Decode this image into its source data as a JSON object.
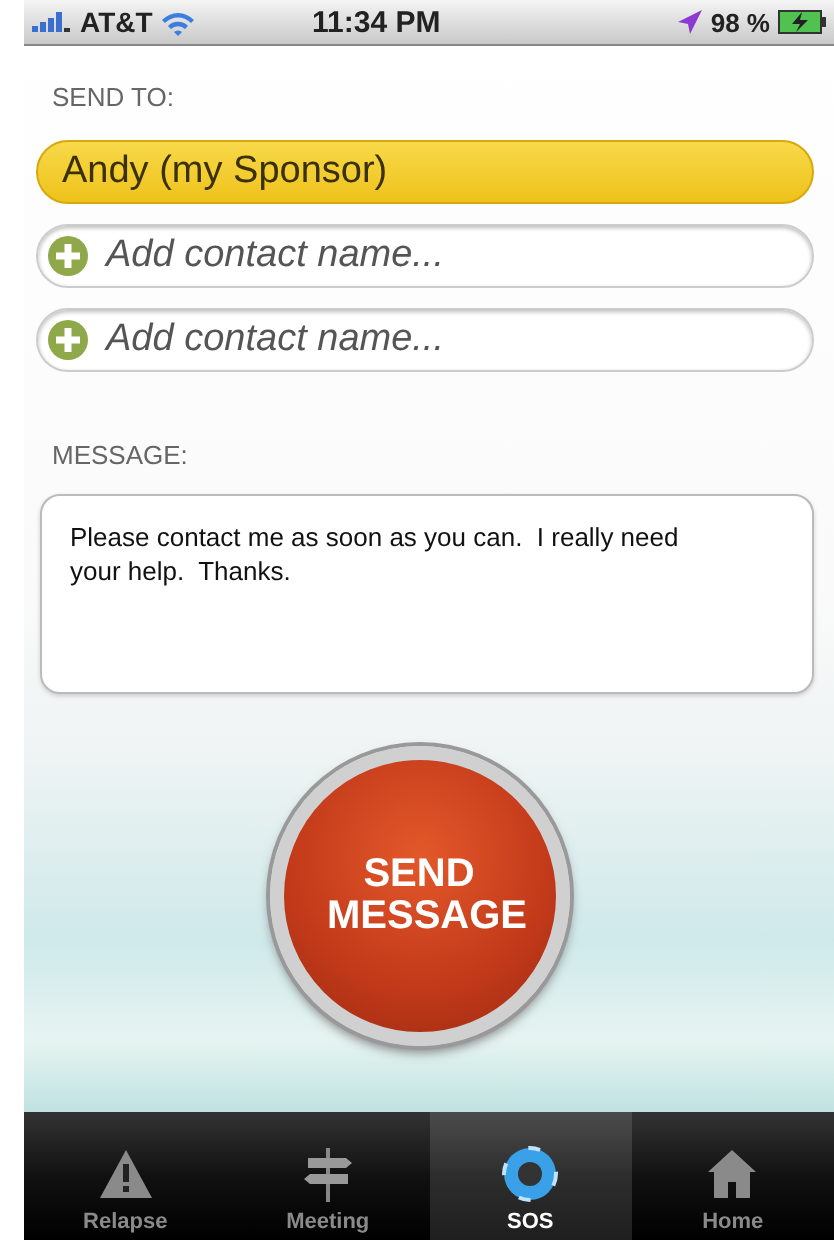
{
  "status_bar": {
    "carrier": "AT&T",
    "time": "11:34 PM",
    "battery": "98 %"
  },
  "send_to": {
    "label": "SEND TO:",
    "recipients": [
      {
        "kind": "contact",
        "text": "Andy (my Sponsor)"
      },
      {
        "kind": "add",
        "placeholder": "Add contact name..."
      },
      {
        "kind": "add",
        "placeholder": "Add contact name..."
      }
    ]
  },
  "message": {
    "label": "MESSAGE:",
    "value": "Please contact me as soon as you can.  I really need your help.  Thanks."
  },
  "send_button": {
    "label": "SEND MESSAGE"
  },
  "tabs": [
    {
      "label": "Relapse",
      "selected": false
    },
    {
      "label": "Meeting",
      "selected": false
    },
    {
      "label": "SOS",
      "selected": true
    },
    {
      "label": "Home",
      "selected": false
    }
  ]
}
